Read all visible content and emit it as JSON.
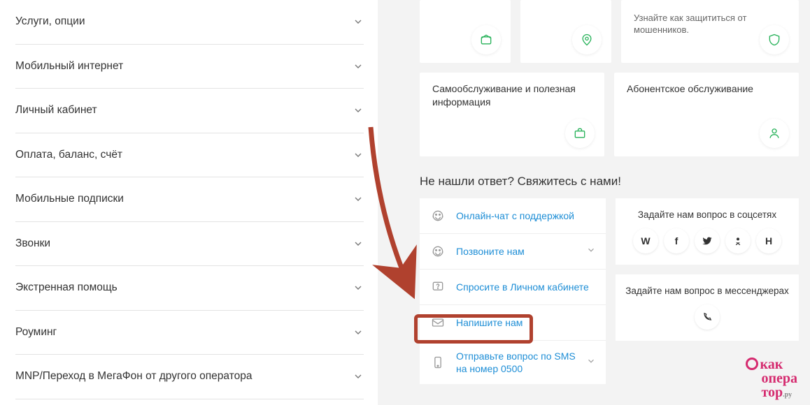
{
  "accordion": [
    {
      "label": "Услуги, опции"
    },
    {
      "label": "Мобильный интернет"
    },
    {
      "label": "Личный кабинет"
    },
    {
      "label": "Оплата, баланс, счёт"
    },
    {
      "label": "Мобильные подписки"
    },
    {
      "label": "Звонки"
    },
    {
      "label": "Экстренная помощь"
    },
    {
      "label": "Роуминг"
    },
    {
      "label": "MNP/Переход в МегаФон от другого оператора"
    }
  ],
  "top_cards": [
    {
      "title": "",
      "sub": ""
    },
    {
      "title": "",
      "sub": ""
    },
    {
      "title": "",
      "sub": "Узнайте как защититься от мошенников."
    }
  ],
  "mid_cards": [
    {
      "title": "Самообслуживание и полезная информация"
    },
    {
      "title": "Абонентское обслуживание"
    }
  ],
  "contacts_heading": "Не нашли ответ? Свяжитесь с нами!",
  "contacts": [
    {
      "label": "Онлайн-чат с поддержкой"
    },
    {
      "label": "Позвоните нам"
    },
    {
      "label": "Спросите в Личном кабинете"
    },
    {
      "label": "Напишите нам"
    },
    {
      "label": "Отправьте вопрос по SMS на номер 0500"
    }
  ],
  "social": {
    "title": "Задайте нам вопрос в соцсетях",
    "items": [
      "vk",
      "fb",
      "tw",
      "ok",
      "habr"
    ]
  },
  "messengers": {
    "title": "Задайте нам вопрос в мессенджерах"
  },
  "watermark": {
    "line1": "как",
    "line2": "опера",
    "line3": "тор"
  }
}
